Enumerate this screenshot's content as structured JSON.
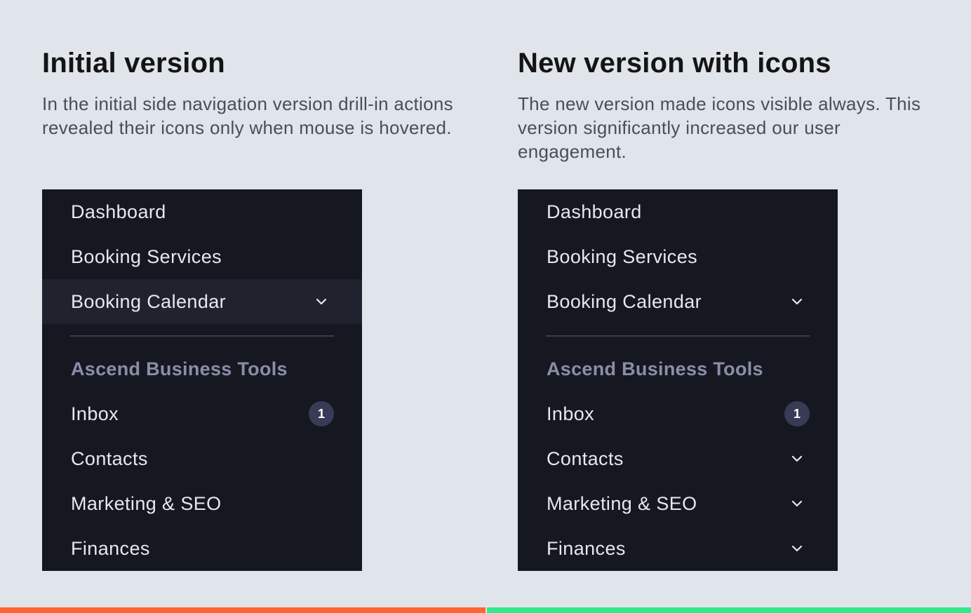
{
  "left": {
    "heading": "Initial version",
    "description": "In the initial side navigation version drill-in actions revealed their icons only when mouse is hovered.",
    "nav": {
      "items_top": [
        {
          "label": "Dashboard"
        },
        {
          "label": "Booking Services"
        },
        {
          "label": "Booking Calendar",
          "icon": "chevron-down-icon",
          "hovered": true
        }
      ],
      "section_title": "Ascend Business Tools",
      "items_bottom": [
        {
          "label": "Inbox",
          "badge": "1"
        },
        {
          "label": "Contacts"
        },
        {
          "label": "Marketing & SEO"
        },
        {
          "label": "Finances"
        }
      ]
    },
    "bar_color": "#ff6433"
  },
  "right": {
    "heading": "New version with icons",
    "description": "The new version made icons visible always. This version significantly increased our user engagement.",
    "nav": {
      "items_top": [
        {
          "label": "Dashboard"
        },
        {
          "label": "Booking Services"
        },
        {
          "label": "Booking Calendar",
          "icon": "chevron-down-icon"
        }
      ],
      "section_title": "Ascend Business Tools",
      "items_bottom": [
        {
          "label": "Inbox",
          "badge": "1"
        },
        {
          "label": "Contacts",
          "icon": "chevron-down-icon"
        },
        {
          "label": "Marketing & SEO",
          "icon": "chevron-down-icon"
        },
        {
          "label": "Finances",
          "icon": "chevron-down-icon"
        }
      ]
    },
    "bar_color": "#33e88a"
  },
  "colors": {
    "background": "#e0e4eb",
    "panel": "#151821",
    "hover": "#20232d",
    "section_title": "#8b8ea8",
    "badge": "#373b55"
  }
}
